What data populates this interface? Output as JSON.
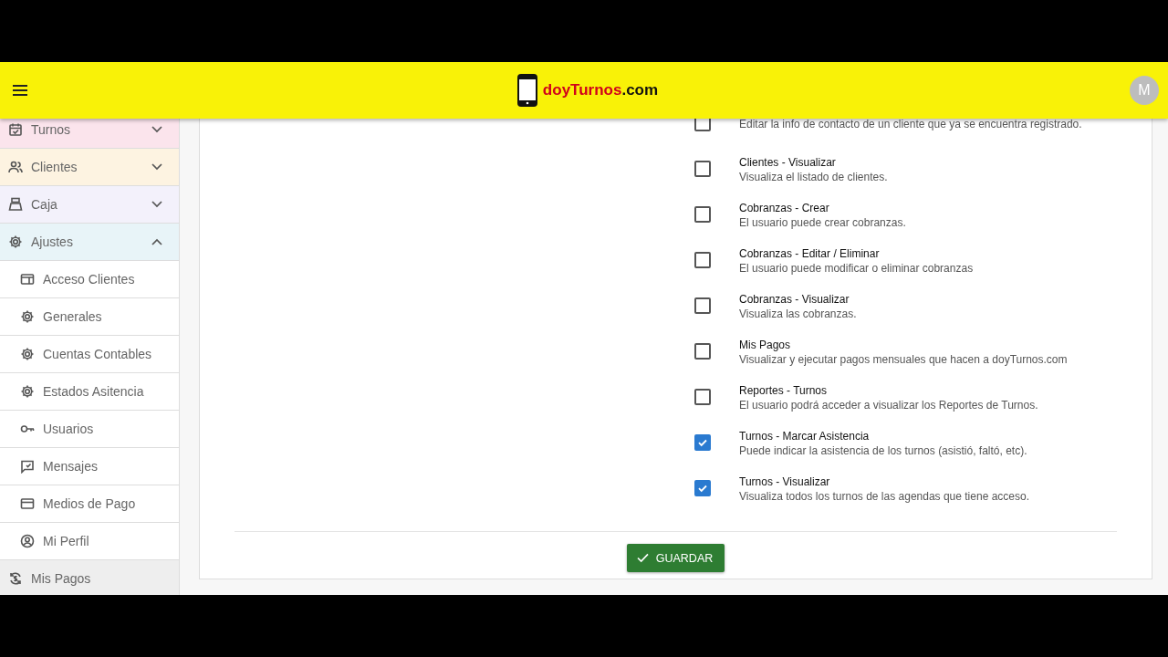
{
  "header": {
    "logo": {
      "brand": "doyTurnos",
      "suffix": ".com"
    },
    "avatar": "M"
  },
  "sidebar": {
    "items": [
      {
        "label": "Turnos",
        "kind": "group",
        "expanded": false,
        "color": "#fbe4ec"
      },
      {
        "label": "Clientes",
        "kind": "group",
        "expanded": false,
        "color": "#fdf3e1"
      },
      {
        "label": "Caja",
        "kind": "group",
        "expanded": false,
        "color": "#f3f1fb"
      },
      {
        "label": "Ajustes",
        "kind": "group",
        "expanded": true,
        "color": "#e8f4f8",
        "children": [
          {
            "label": "Acceso Clientes"
          },
          {
            "label": "Generales"
          },
          {
            "label": "Cuentas Contables"
          },
          {
            "label": "Estados Asitencia"
          },
          {
            "label": "Usuarios"
          },
          {
            "label": "Mensajes"
          },
          {
            "label": "Medios de Pago"
          },
          {
            "label": "Mi Perfil"
          }
        ]
      },
      {
        "label": "Mis Pagos",
        "kind": "link",
        "color": "#eeeeee"
      }
    ]
  },
  "permissions": [
    {
      "description": "Editar la info de contacto de un cliente que ya se encuentra registrado.",
      "checked": false
    },
    {
      "label": "Clientes - Visualizar",
      "description": "Visualiza el listado de clientes.",
      "checked": false
    },
    {
      "label": "Cobranzas - Crear",
      "description": "El usuario puede crear cobranzas.",
      "checked": false
    },
    {
      "label": "Cobranzas - Editar / Eliminar",
      "description": "El usuario puede modificar o eliminar cobranzas",
      "checked": false
    },
    {
      "label": "Cobranzas - Visualizar",
      "description": "Visualiza las cobranzas.",
      "checked": false
    },
    {
      "label": "Mis Pagos",
      "description": "Visualizar y ejecutar pagos mensuales que hacen a doyTurnos.com",
      "checked": false
    },
    {
      "label": "Reportes - Turnos",
      "description": "El usuario podrá acceder a visualizar los Reportes de Turnos.",
      "checked": false
    },
    {
      "label": "Turnos - Marcar Asistencia",
      "description": "Puede indicar la asistencia de los turnos (asistió, faltó, etc).",
      "checked": true
    },
    {
      "label": "Turnos - Visualizar",
      "description": "Visualiza todos los turnos de las agendas que tiene acceso.",
      "checked": true
    }
  ],
  "save_button": "GUARDAR"
}
